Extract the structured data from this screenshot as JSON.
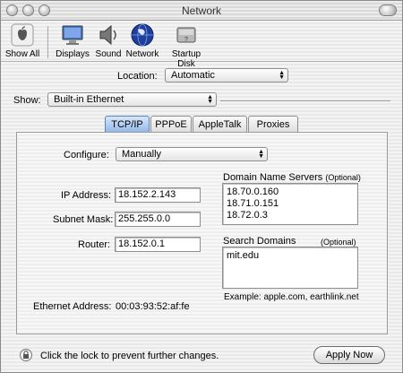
{
  "window": {
    "title": "Network"
  },
  "toolbar": {
    "items": [
      {
        "label": "Show All"
      },
      {
        "label": "Displays"
      },
      {
        "label": "Sound"
      },
      {
        "label": "Network"
      },
      {
        "label": "Startup Disk"
      }
    ]
  },
  "location": {
    "label": "Location:",
    "value": "Automatic"
  },
  "show": {
    "label": "Show:",
    "value": "Built-in Ethernet"
  },
  "tabs": [
    {
      "label": "TCP/IP",
      "active": true
    },
    {
      "label": "PPPoE",
      "active": false
    },
    {
      "label": "AppleTalk",
      "active": false
    },
    {
      "label": "Proxies",
      "active": false
    }
  ],
  "tcpip": {
    "configure_label": "Configure:",
    "configure_value": "Manually",
    "ip_label": "IP Address:",
    "ip_value": "18.152.2.143",
    "subnet_label": "Subnet Mask:",
    "subnet_value": "255.255.0.0",
    "router_label": "Router:",
    "router_value": "18.152.0.1",
    "dns_label": "Domain Name Servers",
    "dns_optional": "(Optional)",
    "dns_values": [
      "18.70.0.160",
      "18.71.0.151",
      "18.72.0.3"
    ],
    "search_label": "Search Domains",
    "search_optional": "(Optional)",
    "search_values": [
      "mit.edu"
    ],
    "example_text": "Example: apple.com, earthlink.net",
    "ethernet_label": "Ethernet Address:",
    "ethernet_value": "00:03:93:52:af:fe"
  },
  "footer": {
    "lock_text": "Click the lock to prevent further changes.",
    "apply_label": "Apply Now"
  },
  "colors": {
    "tab_active": "#8fb6e8",
    "tab_active_border": "#5b83b8"
  }
}
